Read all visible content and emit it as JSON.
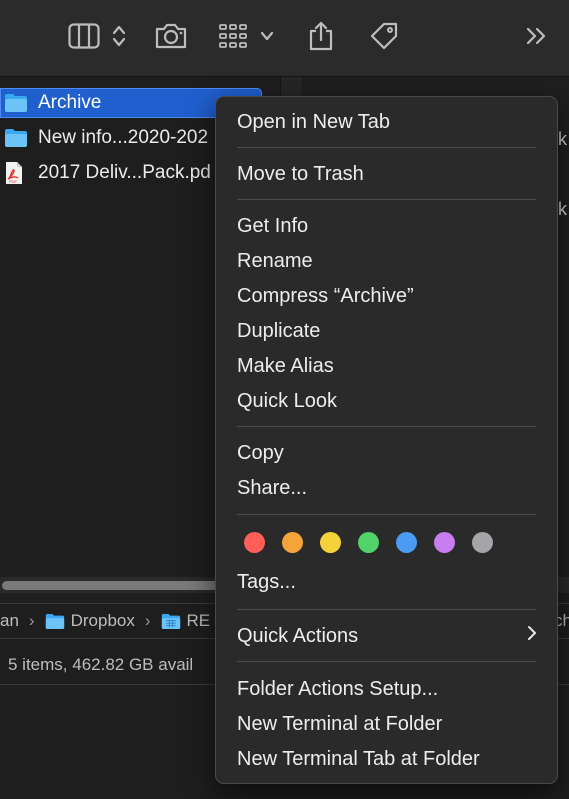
{
  "toolbar": {
    "icons": [
      "columns-view-icon",
      "view-options-chevrons-icon",
      "camera-icon",
      "group-by-icon",
      "group-chevron-down-icon",
      "share-icon",
      "tag-icon",
      "more-chevrons-icon"
    ]
  },
  "files": [
    {
      "name": "Archive",
      "type": "folder",
      "selected": true
    },
    {
      "name": "New info...2020-202",
      "type": "folder",
      "selected": false
    },
    {
      "name": "2017 Deliv...Pack.pd",
      "type": "pdf",
      "selected": false
    }
  ],
  "right_pane": {
    "fragment_1": "k",
    "fragment_2": "k"
  },
  "pathbar": {
    "items": [
      "an",
      "Dropbox",
      "RE",
      "ch"
    ]
  },
  "status": {
    "text": "5 items, 462.82 GB avail"
  },
  "menu": {
    "items": {
      "open_new_tab": "Open in New Tab",
      "move_to_trash": "Move to Trash",
      "get_info": "Get Info",
      "rename": "Rename",
      "compress": "Compress “Archive”",
      "duplicate": "Duplicate",
      "make_alias": "Make Alias",
      "quick_look": "Quick Look",
      "copy": "Copy",
      "share": "Share...",
      "tags": "Tags...",
      "quick_actions": "Quick Actions",
      "folder_actions_setup": "Folder Actions Setup...",
      "new_terminal": "New Terminal at Folder",
      "new_terminal_tab": "New Terminal Tab at Folder"
    },
    "tag_colors": [
      {
        "name": "red",
        "hex": "#ff5f57"
      },
      {
        "name": "orange",
        "hex": "#f5a43a"
      },
      {
        "name": "yellow",
        "hex": "#f3d23c"
      },
      {
        "name": "green",
        "hex": "#52d36a"
      },
      {
        "name": "blue",
        "hex": "#4a9cf2"
      },
      {
        "name": "purple",
        "hex": "#c77cf0"
      },
      {
        "name": "gray",
        "hex": "#a5a5a9"
      }
    ]
  },
  "colors": {
    "selection": "#1f5fce",
    "folder": "#3aa8f0"
  }
}
